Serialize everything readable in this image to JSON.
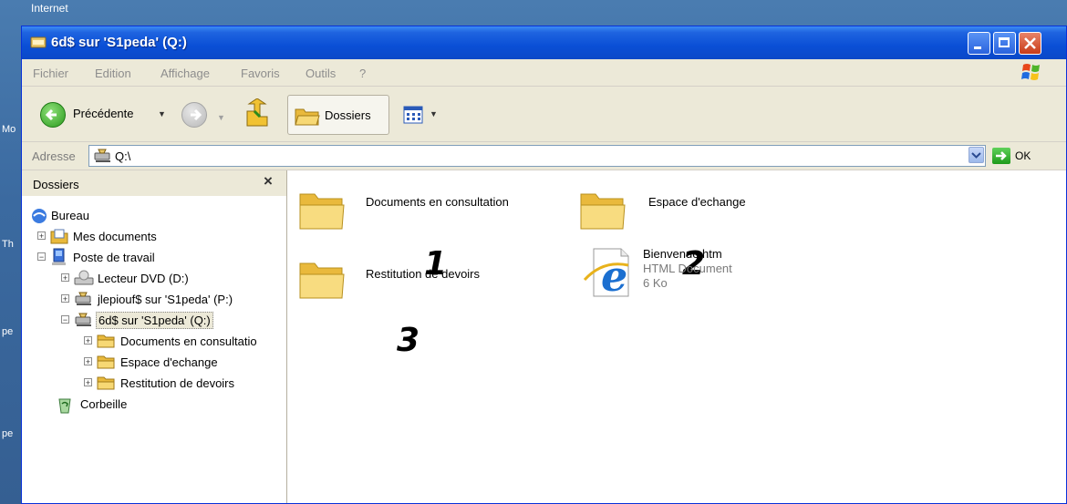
{
  "desktop": {
    "top_label": "Internet",
    "side_labels": [
      "Mo",
      "Th",
      "pe",
      "pe"
    ]
  },
  "window": {
    "title": "6d$ sur 'S1peda' (Q:)",
    "controls": {
      "minimize": "minimize",
      "maximize": "maximize",
      "close": "close"
    }
  },
  "menu": {
    "items": [
      "Fichier",
      "Edition",
      "Affichage",
      "Favoris",
      "Outils",
      "?"
    ]
  },
  "toolbar": {
    "back_label": "Précédente",
    "folders_label": "Dossiers"
  },
  "address": {
    "label": "Adresse",
    "value": "Q:\\",
    "go_label": "OK"
  },
  "tree": {
    "title": "Dossiers",
    "close_glyph": "×",
    "items": [
      {
        "label": "Bureau",
        "level": 0
      },
      {
        "label": "Mes documents",
        "level": 1,
        "expander": "+"
      },
      {
        "label": "Poste de travail",
        "level": 1,
        "expander": "−"
      },
      {
        "label": "Lecteur DVD (D:)",
        "level": 2,
        "expander": "+"
      },
      {
        "label": "jlepiouf$ sur 'S1peda' (P:)",
        "level": 2,
        "expander": "+"
      },
      {
        "label": "6d$ sur 'S1peda' (Q:)",
        "level": 2,
        "expander": "−",
        "selected": true
      },
      {
        "label": "Documents en consultatio",
        "level": 3,
        "expander": "+"
      },
      {
        "label": "Espace d'echange",
        "level": 3,
        "expander": "+"
      },
      {
        "label": "Restitution de devoirs",
        "level": 3,
        "expander": "+"
      },
      {
        "label": "Corbeille",
        "level": 0
      }
    ]
  },
  "content": {
    "items": [
      {
        "name": "Documents en consultation",
        "annotation": "1"
      },
      {
        "name": "Espace d'echange",
        "annotation": "2"
      },
      {
        "name": "Restitution de devoirs",
        "annotation": "3"
      },
      {
        "name": "Bienvenue.htm",
        "type": "HTML Document",
        "size": "6 Ko"
      }
    ]
  },
  "colors": {
    "titlebar": "#0a4fd6",
    "desktop": "#3a6ea5",
    "go_green": "#1e9a1a"
  }
}
